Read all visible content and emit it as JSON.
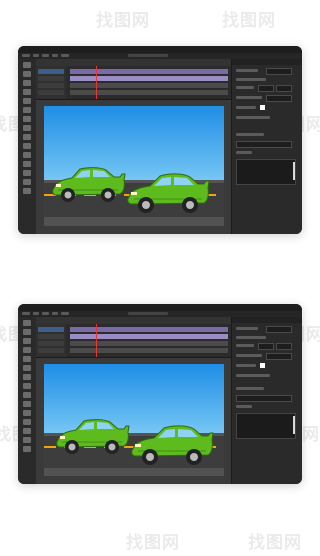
{
  "watermark": {
    "text": "找图网"
  },
  "screenshots": [
    {
      "id": "top",
      "app": {
        "theme": "dark",
        "tool_icons": [
          "selection-tool-icon",
          "subselect-tool-icon",
          "free-transform-icon",
          "pen-tool-icon",
          "text-tool-icon",
          "line-tool-icon",
          "rectangle-tool-icon",
          "oval-tool-icon",
          "pencil-tool-icon",
          "brush-tool-icon",
          "paint-bucket-icon",
          "eyedropper-icon",
          "eraser-icon",
          "hand-tool-icon",
          "zoom-tool-icon"
        ]
      },
      "stage": {
        "sky_color": "#1e8ee6",
        "road_color": "#3d3d3d",
        "lane_color": "#f6a10f",
        "car_color": "#5dbb1e"
      }
    },
    {
      "id": "bottom",
      "app": {
        "theme": "dark",
        "tool_icons": [
          "selection-tool-icon",
          "subselect-tool-icon",
          "free-transform-icon",
          "pen-tool-icon",
          "text-tool-icon",
          "line-tool-icon",
          "rectangle-tool-icon",
          "oval-tool-icon",
          "pencil-tool-icon",
          "brush-tool-icon",
          "paint-bucket-icon",
          "eyedropper-icon",
          "eraser-icon",
          "hand-tool-icon",
          "zoom-tool-icon"
        ]
      },
      "stage": {
        "sky_color": "#1e8ee6",
        "road_color": "#3d3d3d",
        "lane_color": "#f6a10f",
        "car_color": "#5dbb1e"
      }
    }
  ]
}
